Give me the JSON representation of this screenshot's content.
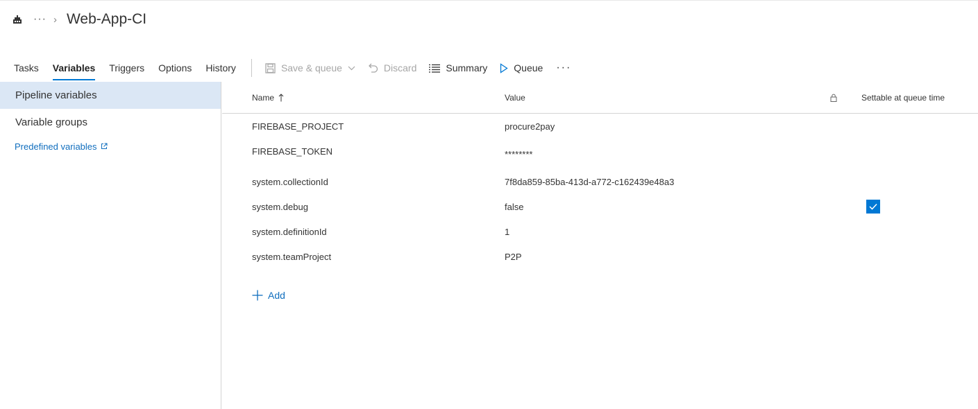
{
  "breadcrumb": {
    "ellipsis": "···",
    "chevron": "›",
    "title": "Web-App-CI"
  },
  "tabs": [
    {
      "label": "Tasks"
    },
    {
      "label": "Variables",
      "active": true
    },
    {
      "label": "Triggers"
    },
    {
      "label": "Options"
    },
    {
      "label": "History"
    }
  ],
  "commands": {
    "save_queue": "Save & queue",
    "discard": "Discard",
    "summary": "Summary",
    "queue": "Queue",
    "more": "···"
  },
  "leftnav": {
    "pipeline_variables": "Pipeline variables",
    "variable_groups": "Variable groups",
    "predefined_variables": "Predefined variables"
  },
  "grid": {
    "headers": {
      "name": "Name",
      "value": "Value",
      "settable": "Settable at queue time"
    },
    "rows": [
      {
        "name": "FIREBASE_PROJECT",
        "value": "procure2pay",
        "settable": false
      },
      {
        "name": "FIREBASE_TOKEN",
        "value": "********",
        "settable": false
      },
      {
        "name": "system.collectionId",
        "value": "7f8da859-85ba-413d-a772-c162439e48a3",
        "settable": false
      },
      {
        "name": "system.debug",
        "value": "false",
        "settable": true
      },
      {
        "name": "system.definitionId",
        "value": "1",
        "settable": false
      },
      {
        "name": "system.teamProject",
        "value": "P2P",
        "settable": false
      }
    ],
    "add_label": "Add"
  },
  "colors": {
    "accent": "#0078d4",
    "link": "#106ebe",
    "selected_nav_bg": "#dbe7f5"
  }
}
